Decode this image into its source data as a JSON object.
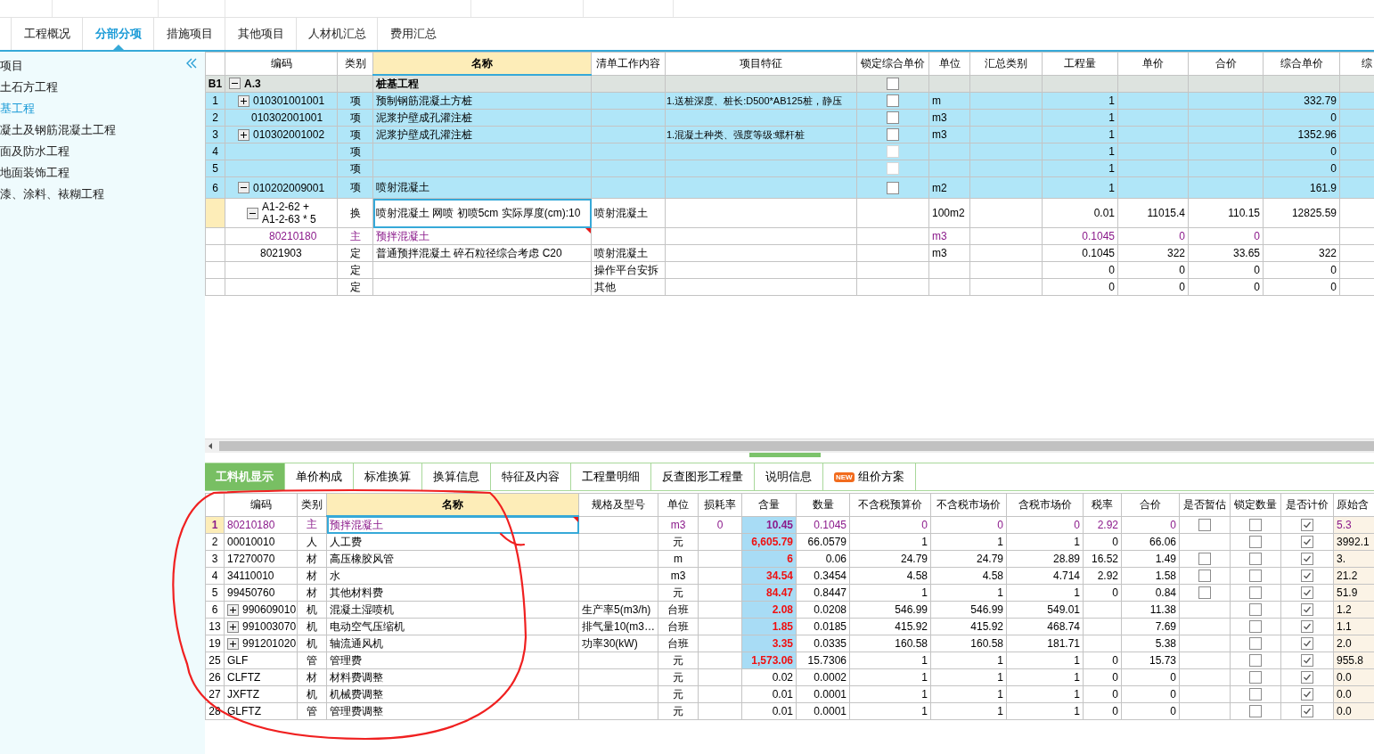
{
  "main_tabs": [
    {
      "label": "工程概况",
      "selected": false
    },
    {
      "label": "分部分项",
      "selected": true
    },
    {
      "label": "措施项目",
      "selected": false
    },
    {
      "label": "其他项目",
      "selected": false
    },
    {
      "label": "人材机汇总",
      "selected": false
    },
    {
      "label": "费用汇总",
      "selected": false
    }
  ],
  "sidebar": {
    "items": [
      {
        "label": "项目",
        "selected": false
      },
      {
        "label": "土石方工程",
        "selected": false
      },
      {
        "label": "基工程",
        "selected": true
      },
      {
        "label": "凝土及钢筋混凝土工程",
        "selected": false
      },
      {
        "label": "面及防水工程",
        "selected": false
      },
      {
        "label": "地面装饰工程",
        "selected": false
      },
      {
        "label": "漆、涂料、裱糊工程",
        "selected": false
      }
    ]
  },
  "top_table": {
    "columns": [
      {
        "label": "编码",
        "selected": false
      },
      {
        "label": "类别",
        "selected": false
      },
      {
        "label": "名称",
        "selected": true
      },
      {
        "label": "清单工作内容",
        "selected": false
      },
      {
        "label": "项目特征",
        "selected": false
      },
      {
        "label": "锁定综合单价",
        "selected": false
      },
      {
        "label": "单位",
        "selected": false
      },
      {
        "label": "汇总类别",
        "selected": false
      },
      {
        "label": "工程量",
        "selected": false
      },
      {
        "label": "单价",
        "selected": false
      },
      {
        "label": "合价",
        "selected": false
      },
      {
        "label": "综合单价",
        "selected": false
      },
      {
        "label": "综",
        "selected": false
      }
    ],
    "rows": [
      {
        "row_header": "B1",
        "code": "A.3",
        "name": "桩基工程",
        "lock": {
          "checked": false,
          "disabled": false
        },
        "kind": "section",
        "selected": false,
        "marked": false,
        "expanded": true,
        "children": [
          {
            "row_header": "1",
            "code": "010301001001",
            "type": "项",
            "name": "预制钢筋混凝土方桩",
            "features": "1.送桩深度、桩长:D500*AB125桩，静压",
            "lock": {
              "checked": false,
              "disabled": false
            },
            "unit": "m",
            "quantity": "1",
            "comprehensive_price": "332.79",
            "kind": "item",
            "selected": false,
            "marked": false,
            "expanded": false
          },
          {
            "row_header": "2",
            "code": "010302001001",
            "type": "项",
            "name": "泥浆护壁成孔灌注桩",
            "lock": {
              "checked": false,
              "disabled": false
            },
            "unit": "m3",
            "quantity": "1",
            "comprehensive_price": "0",
            "kind": "item",
            "selected": false,
            "marked": false
          },
          {
            "row_header": "3",
            "code": "010302001002",
            "type": "项",
            "name": "泥浆护壁成孔灌注桩",
            "features": "1.混凝土种类、强度等级:螺杆桩",
            "lock": {
              "checked": false,
              "disabled": false
            },
            "unit": "m3",
            "quantity": "1",
            "comprehensive_price": "1352.96",
            "kind": "item",
            "selected": false,
            "marked": false,
            "expanded": false
          },
          {
            "row_header": "4",
            "type": "项",
            "lock": {
              "checked": false,
              "disabled": true
            },
            "quantity": "1",
            "comprehensive_price": "0",
            "kind": "item",
            "selected": false,
            "marked": false
          },
          {
            "row_header": "5",
            "type": "项",
            "lock": {
              "checked": false,
              "disabled": true
            },
            "quantity": "1",
            "comprehensive_price": "0",
            "kind": "item",
            "selected": false,
            "marked": false
          },
          {
            "row_header": "6",
            "code": "010202009001",
            "type": "项",
            "name": "喷射混凝土",
            "lock": {
              "checked": false,
              "disabled": false
            },
            "unit": "m2",
            "quantity": "1",
            "comprehensive_price": "161.9",
            "kind": "item",
            "selected": false,
            "marked": false,
            "expanded": true,
            "children": [
              {
                "code": "A1-2-62 + A1-2-63 * 5",
                "type": "换",
                "name": "喷射混凝土 网喷 初喷5cm  实际厚度(cm):10",
                "work_content": "喷射混凝土",
                "unit": "100m2",
                "quantity": "0.01",
                "unit_price": "11015.4",
                "total": "110.15",
                "comprehensive_price": "12825.59",
                "kind": "quota",
                "selected": true,
                "marked": false,
                "expanded": true,
                "children": [
                  {
                    "code": "80210180",
                    "type": "主",
                    "name": "预拌混凝土",
                    "unit": "m3",
                    "quantity": "0.1045",
                    "unit_price": "0",
                    "total": "0",
                    "kind": "material",
                    "selected": false,
                    "marked": true
                  }
                ]
              },
              {
                "code": "8021903",
                "type": "定",
                "name": "普通预拌混凝土 碎石粒径综合考虑 C20",
                "work_content": "喷射混凝土",
                "unit": "m3",
                "quantity": "0.1045",
                "unit_price": "322",
                "total": "33.65",
                "comprehensive_price": "322",
                "kind": "quota",
                "selected": false,
                "marked": false
              },
              {
                "type": "定",
                "work_content": "操作平台安拆",
                "quantity": "0",
                "unit_price": "0",
                "total": "0",
                "comprehensive_price": "0",
                "kind": "quota",
                "selected": false,
                "marked": false
              },
              {
                "type": "定",
                "work_content": "其他",
                "quantity": "0",
                "unit_price": "0",
                "total": "0",
                "comprehensive_price": "0",
                "kind": "quota",
                "selected": false,
                "marked": false
              }
            ]
          }
        ]
      }
    ]
  },
  "bottom_tabs": [
    {
      "label": "工料机显示",
      "selected": true
    },
    {
      "label": "单价构成",
      "selected": false
    },
    {
      "label": "标准换算",
      "selected": false
    },
    {
      "label": "换算信息",
      "selected": false
    },
    {
      "label": "特征及内容",
      "selected": false
    },
    {
      "label": "工程量明细",
      "selected": false
    },
    {
      "label": "反查图形工程量",
      "selected": false
    },
    {
      "label": "说明信息",
      "selected": false
    },
    {
      "label": "组价方案",
      "selected": false,
      "badge": "NEW"
    }
  ],
  "bottom_table": {
    "columns": [
      {
        "label": "编码",
        "selected": false
      },
      {
        "label": "类别",
        "selected": false
      },
      {
        "label": "名称",
        "selected": true
      },
      {
        "label": "规格及型号",
        "selected": false
      },
      {
        "label": "单位",
        "selected": false
      },
      {
        "label": "损耗率",
        "selected": false
      },
      {
        "label": "含量",
        "selected": false
      },
      {
        "label": "数量",
        "selected": false
      },
      {
        "label": "不含税预算价",
        "selected": false
      },
      {
        "label": "不含税市场价",
        "selected": false
      },
      {
        "label": "含税市场价",
        "selected": false
      },
      {
        "label": "税率",
        "selected": false
      },
      {
        "label": "合价",
        "selected": false
      },
      {
        "label": "是否暂估",
        "selected": false
      },
      {
        "label": "锁定数量",
        "selected": false
      },
      {
        "label": "是否计价",
        "selected": false
      },
      {
        "label": "原始含",
        "selected": false
      }
    ],
    "rows": [
      {
        "row_header": "1",
        "code": "80210180",
        "type": "主",
        "name": "预拌混凝土",
        "unit": "m3",
        "loss_rate": "0",
        "content": "10.45",
        "content_highlight": true,
        "amount": "0.1045",
        "budget_price": "0",
        "market_price": "0",
        "market_price_tax": "0",
        "tax_rate": "2.92",
        "total": "0",
        "provisional": false,
        "lock_qty": false,
        "priced": true,
        "original": "5.3",
        "kind": "material",
        "selected": true,
        "marked": true
      },
      {
        "row_header": "2",
        "code": "00010010",
        "type": "人",
        "name": "人工费",
        "unit": "元",
        "content": "6,605.79",
        "content_highlight": true,
        "amount": "66.0579",
        "budget_price": "1",
        "market_price": "1",
        "market_price_tax": "1",
        "tax_rate": "0",
        "total": "66.06",
        "lock_qty": false,
        "priced": true,
        "original": "3992.1",
        "kind": "normal",
        "selected": false,
        "marked": false
      },
      {
        "row_header": "3",
        "code": "17270070",
        "type": "材",
        "name": "高压橡胶风管",
        "unit": "m",
        "content": "6",
        "content_highlight": true,
        "amount": "0.06",
        "budget_price": "24.79",
        "market_price": "24.79",
        "market_price_tax": "28.89",
        "tax_rate": "16.52",
        "total": "1.49",
        "provisional": false,
        "lock_qty": false,
        "priced": true,
        "original": "3.",
        "kind": "normal",
        "selected": false,
        "marked": false
      },
      {
        "row_header": "4",
        "code": "34110010",
        "type": "材",
        "name": "水",
        "unit": "m3",
        "content": "34.54",
        "content_highlight": true,
        "amount": "0.3454",
        "budget_price": "4.58",
        "market_price": "4.58",
        "market_price_tax": "4.714",
        "tax_rate": "2.92",
        "total": "1.58",
        "provisional": false,
        "lock_qty": false,
        "priced": true,
        "original": "21.2",
        "kind": "normal",
        "selected": false,
        "marked": false
      },
      {
        "row_header": "5",
        "code": "99450760",
        "type": "材",
        "name": "其他材料费",
        "unit": "元",
        "content": "84.47",
        "content_highlight": true,
        "amount": "0.8447",
        "budget_price": "1",
        "market_price": "1",
        "market_price_tax": "1",
        "tax_rate": "0",
        "total": "0.84",
        "provisional": false,
        "lock_qty": false,
        "priced": true,
        "original": "51.9",
        "kind": "normal",
        "selected": false,
        "marked": false
      },
      {
        "row_header": "6",
        "code": "990609010",
        "expanded": false,
        "type": "机",
        "name": "混凝土湿喷机",
        "spec": "生产率5(m3/h)",
        "unit": "台班",
        "content": "2.08",
        "content_highlight": true,
        "amount": "0.0208",
        "budget_price": "546.99",
        "market_price": "546.99",
        "market_price_tax": "549.01",
        "total": "11.38",
        "lock_qty": false,
        "priced": true,
        "original": "1.2",
        "kind": "normal",
        "selected": false,
        "marked": false
      },
      {
        "row_header": "13",
        "code": "991003070",
        "expanded": false,
        "type": "机",
        "name": "电动空气压缩机",
        "spec": "排气量10(m3…",
        "unit": "台班",
        "content": "1.85",
        "content_highlight": true,
        "amount": "0.0185",
        "budget_price": "415.92",
        "market_price": "415.92",
        "market_price_tax": "468.74",
        "total": "7.69",
        "lock_qty": false,
        "priced": true,
        "original": "1.1",
        "kind": "normal",
        "selected": false,
        "marked": false
      },
      {
        "row_header": "19",
        "code": "991201020",
        "expanded": false,
        "type": "机",
        "name": "轴流通风机",
        "spec": "功率30(kW)",
        "unit": "台班",
        "content": "3.35",
        "content_highlight": true,
        "amount": "0.0335",
        "budget_price": "160.58",
        "market_price": "160.58",
        "market_price_tax": "181.71",
        "total": "5.38",
        "lock_qty": false,
        "priced": true,
        "original": "2.0",
        "kind": "normal",
        "selected": false,
        "marked": false
      },
      {
        "row_header": "25",
        "code": "GLF",
        "type": "管",
        "name": "管理费",
        "unit": "元",
        "content": "1,573.06",
        "content_highlight": true,
        "amount": "15.7306",
        "budget_price": "1",
        "market_price": "1",
        "market_price_tax": "1",
        "tax_rate": "0",
        "total": "15.73",
        "lock_qty": false,
        "priced": true,
        "original": "955.8",
        "kind": "normal",
        "selected": false,
        "marked": false
      },
      {
        "row_header": "26",
        "code": "CLFTZ",
        "type": "材",
        "name": "材料费调整",
        "unit": "元",
        "content": "0.02",
        "content_highlight": false,
        "amount": "0.0002",
        "budget_price": "1",
        "market_price": "1",
        "market_price_tax": "1",
        "tax_rate": "0",
        "total": "0",
        "lock_qty": false,
        "priced": true,
        "original": "0.0",
        "kind": "normal",
        "selected": false,
        "marked": false
      },
      {
        "row_header": "27",
        "code": "JXFTZ",
        "type": "机",
        "name": "机械费调整",
        "unit": "元",
        "content": "0.01",
        "content_highlight": false,
        "amount": "0.0001",
        "budget_price": "1",
        "market_price": "1",
        "market_price_tax": "1",
        "tax_rate": "0",
        "total": "0",
        "lock_qty": false,
        "priced": true,
        "original": "0.0",
        "kind": "normal",
        "selected": false,
        "marked": false
      },
      {
        "row_header": "28",
        "code": "GLFTZ",
        "type": "管",
        "name": "管理费调整",
        "unit": "元",
        "content": "0.01",
        "content_highlight": false,
        "amount": "0.0001",
        "budget_price": "1",
        "market_price": "1",
        "market_price_tax": "1",
        "tax_rate": "0",
        "total": "0",
        "lock_qty": false,
        "priced": true,
        "original": "0.0",
        "kind": "normal",
        "selected": false,
        "marked": false
      }
    ]
  }
}
